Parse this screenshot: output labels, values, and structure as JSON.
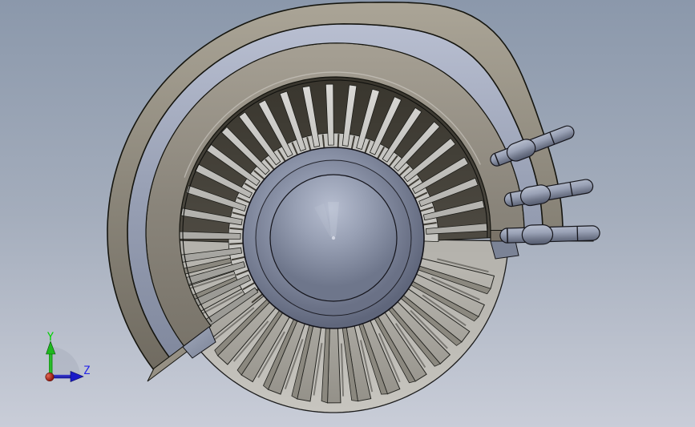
{
  "scene": {
    "type": "cad-viewport",
    "description": "Front view of a turbofan jet engine CAD model with lower nacelle cutaway exposing the fan disc",
    "background": {
      "top": "#8b98ab",
      "middle": "#a4adbc",
      "bottom": "#c9cdd8"
    }
  },
  "model": {
    "spinner_color": "#8d95aa",
    "nacelle_outer_color": "#8d887c",
    "nacelle_accent_color": "#9aa2b6",
    "interior_color": "#4a463e",
    "fan_disc_color": "#bcbab4",
    "stator_vane_color": "#c6c5c1",
    "stator_vane_count": 25,
    "fan_blade_count": 15,
    "pipe_count": 3
  },
  "triad": {
    "y_label": "Y",
    "y_color": "#00d200",
    "z_label": "Z",
    "z_color": "#2525e8",
    "origin_color": "#a01608",
    "arc_color": "#a7adbb"
  }
}
